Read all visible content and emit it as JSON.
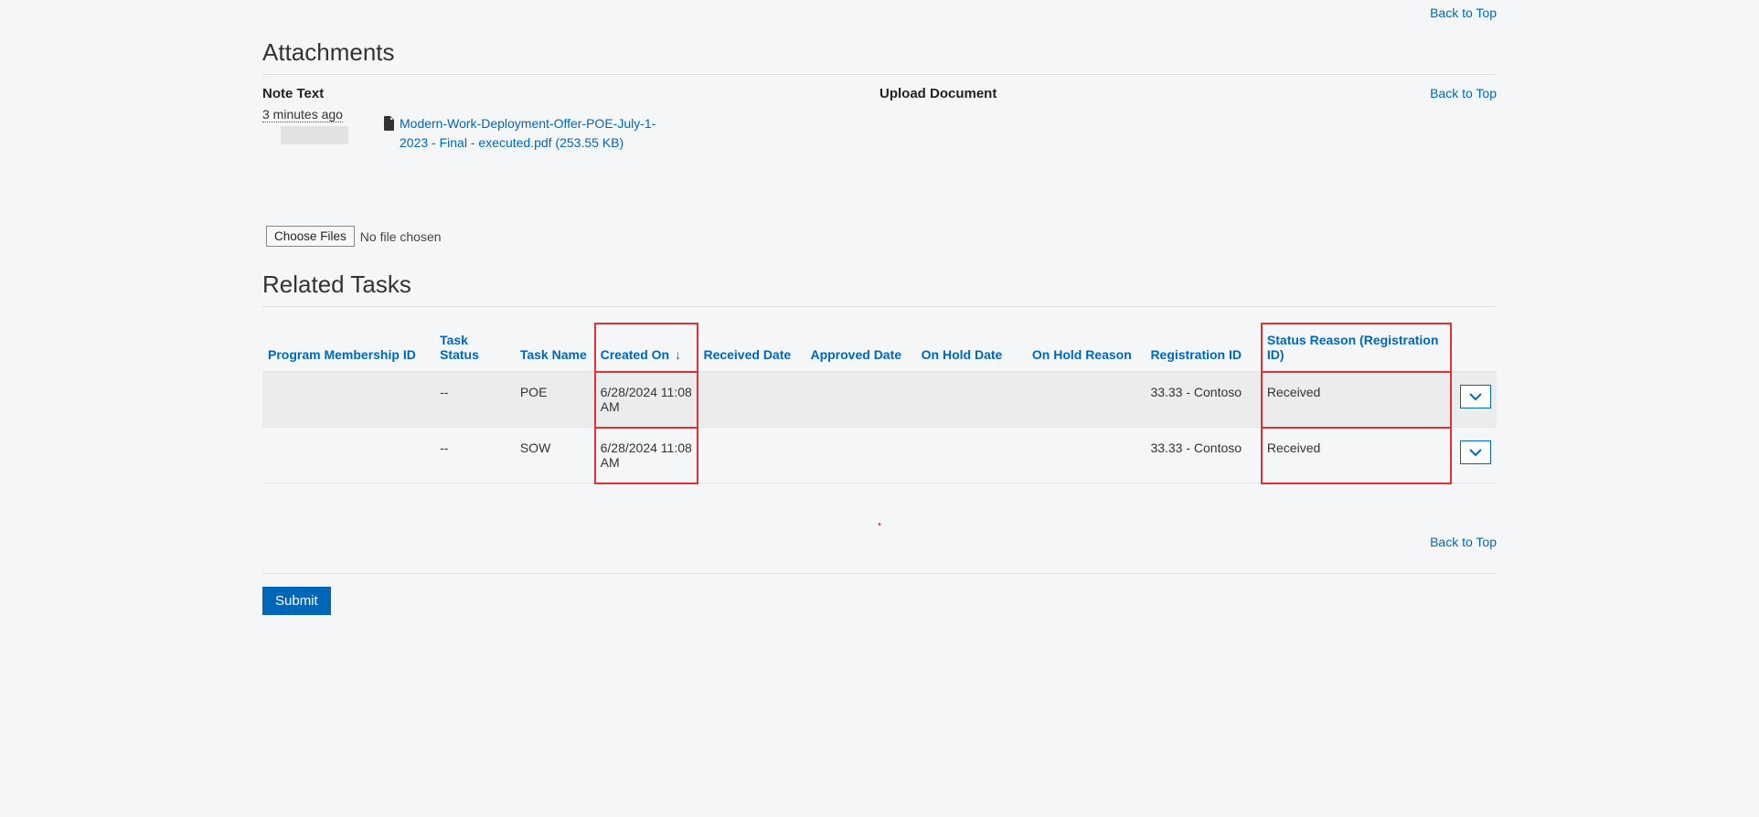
{
  "links": {
    "back_to_top": "Back to Top"
  },
  "attachments": {
    "title": "Attachments",
    "note_text_label": "Note Text",
    "upload_label": "Upload Document",
    "timestamp": "3 minutes ago",
    "file_name": "Modern-Work-Deployment-Offer-POE-July-1-2023 - Final - executed.pdf (253.55 KB)",
    "choose_files_label": "Choose Files",
    "no_file_chosen": "No file chosen"
  },
  "related_tasks": {
    "title": "Related Tasks",
    "columns": {
      "pmid": "Program Membership ID",
      "task_status": "Task Status",
      "task_name": "Task Name",
      "created_on": "Created On",
      "received_date": "Received Date",
      "approved_date": "Approved Date",
      "on_hold_date": "On Hold Date",
      "on_hold_reason": "On Hold Reason",
      "registration_id": "Registration ID",
      "status_reason": "Status Reason (Registration ID)"
    },
    "sort_indicator": "↓",
    "rows": [
      {
        "pmid": "",
        "task_status": "--",
        "task_name": "POE",
        "created_on": "6/28/2024 11:08 AM",
        "received_date": "",
        "approved_date": "",
        "on_hold_date": "",
        "on_hold_reason": "",
        "registration_id": "33.33 - Contoso",
        "status_reason": "Received"
      },
      {
        "pmid": "",
        "task_status": "--",
        "task_name": "SOW",
        "created_on": "6/28/2024 11:08 AM",
        "received_date": "",
        "approved_date": "",
        "on_hold_date": "",
        "on_hold_reason": "",
        "registration_id": "33.33 - Contoso",
        "status_reason": "Received"
      }
    ]
  },
  "submit_label": "Submit",
  "highlight_colors": {
    "box": "#d33"
  }
}
